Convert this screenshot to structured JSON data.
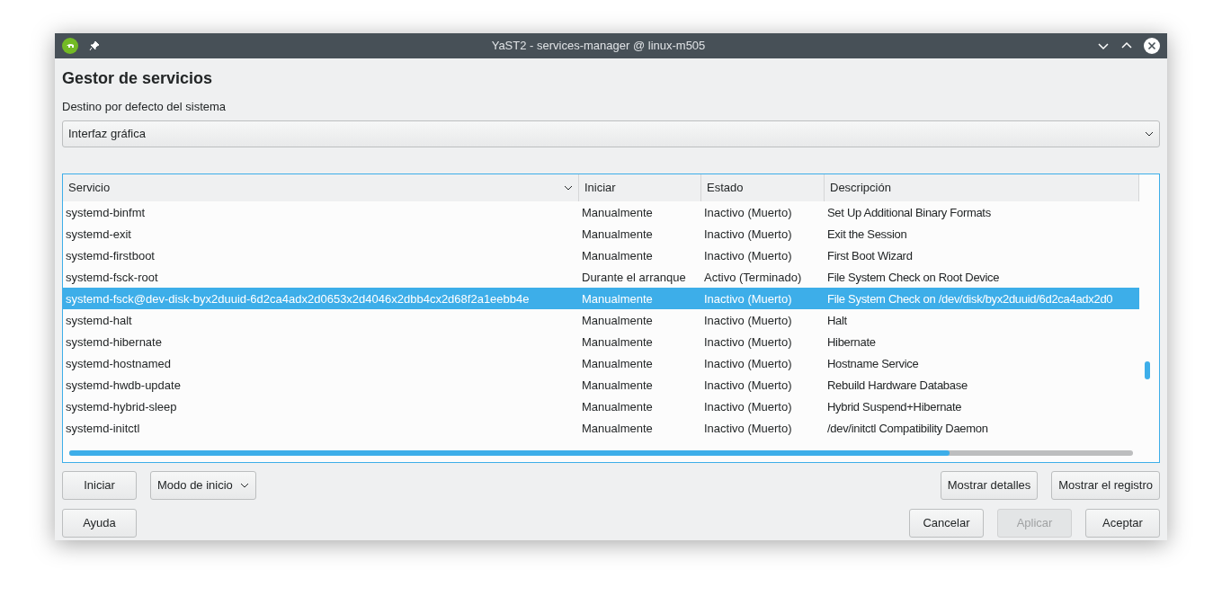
{
  "window": {
    "title": "YaST2 - services-manager @ linux-m505"
  },
  "heading": "Gestor de servicios",
  "target": {
    "label": "Destino por defecto del sistema",
    "value": "Interfaz gráfica"
  },
  "table": {
    "columns": [
      {
        "label": "Servicio",
        "sorted": true
      },
      {
        "label": "Iniciar",
        "sorted": false
      },
      {
        "label": "Estado",
        "sorted": false
      },
      {
        "label": "Descripción",
        "sorted": false
      }
    ],
    "rows": [
      {
        "cells": [
          "systemd-binfmt",
          "Manualmente",
          "Inactivo (Muerto)",
          "Set Up Additional Binary Formats"
        ],
        "selected": false
      },
      {
        "cells": [
          "systemd-exit",
          "Manualmente",
          "Inactivo (Muerto)",
          "Exit the Session"
        ],
        "selected": false
      },
      {
        "cells": [
          "systemd-firstboot",
          "Manualmente",
          "Inactivo (Muerto)",
          "First Boot Wizard"
        ],
        "selected": false
      },
      {
        "cells": [
          "systemd-fsck-root",
          "Durante el arranque",
          "Activo (Terminado)",
          "File System Check on Root Device"
        ],
        "selected": false
      },
      {
        "cells": [
          "systemd-fsck@dev-disk-byx2duuid-6d2ca4adx2d0653x2d4046x2dbb4cx2d68f2a1eebb4e",
          "Manualmente",
          "Inactivo (Muerto)",
          "File System Check on /dev/disk/byx2duuid/6d2ca4adx2d0"
        ],
        "selected": true
      },
      {
        "cells": [
          "systemd-halt",
          "Manualmente",
          "Inactivo (Muerto)",
          "Halt"
        ],
        "selected": false
      },
      {
        "cells": [
          "systemd-hibernate",
          "Manualmente",
          "Inactivo (Muerto)",
          "Hibernate"
        ],
        "selected": false
      },
      {
        "cells": [
          "systemd-hostnamed",
          "Manualmente",
          "Inactivo (Muerto)",
          "Hostname Service"
        ],
        "selected": false
      },
      {
        "cells": [
          "systemd-hwdb-update",
          "Manualmente",
          "Inactivo (Muerto)",
          "Rebuild Hardware Database"
        ],
        "selected": false
      },
      {
        "cells": [
          "systemd-hybrid-sleep",
          "Manualmente",
          "Inactivo (Muerto)",
          "Hybrid Suspend+Hibernate"
        ],
        "selected": false
      },
      {
        "cells": [
          "systemd-initctl",
          "Manualmente",
          "Inactivo (Muerto)",
          "/dev/initctl Compatibility Daemon"
        ],
        "selected": false
      }
    ]
  },
  "buttons_left": [
    {
      "label": "Iniciar",
      "kind": "button"
    },
    {
      "label": "Modo de inicio",
      "kind": "menu"
    }
  ],
  "buttons_right": [
    {
      "label": "Mostrar detalles",
      "disabled": false
    },
    {
      "label": "Mostrar el registro",
      "disabled": false
    }
  ],
  "help_button": {
    "label": "Ayuda"
  },
  "dialog_buttons": [
    {
      "label": "Cancelar",
      "disabled": false
    },
    {
      "label": "Aplicar",
      "disabled": true
    },
    {
      "label": "Aceptar",
      "disabled": false
    }
  ]
}
